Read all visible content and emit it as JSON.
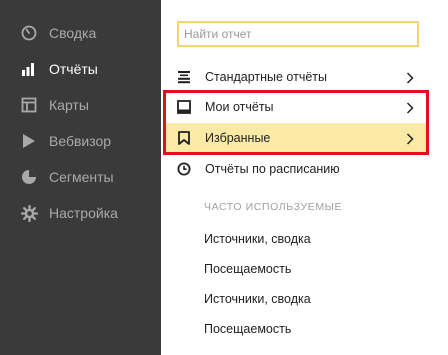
{
  "sidebar": {
    "items": [
      {
        "label": "Сводка",
        "icon": "dashboard-gauge-icon",
        "active": false
      },
      {
        "label": "Отчёты",
        "icon": "bar-chart-icon",
        "active": true
      },
      {
        "label": "Карты",
        "icon": "map-icon",
        "active": false
      },
      {
        "label": "Вебвизор",
        "icon": "play-icon",
        "active": false
      },
      {
        "label": "Сегменты",
        "icon": "pie-segments-icon",
        "active": false
      },
      {
        "label": "Настройка",
        "icon": "gear-icon",
        "active": false
      }
    ]
  },
  "panel": {
    "search_placeholder": "Найти отчет",
    "menu": [
      {
        "label": "Стандартные отчёты",
        "icon": "list-icon",
        "has_arrow": true
      },
      {
        "label": "Мои отчёты",
        "icon": "inbox-icon",
        "has_arrow": true
      },
      {
        "label": "Избранные",
        "icon": "bookmark-icon",
        "has_arrow": true,
        "highlighted": true
      },
      {
        "label": "Отчёты по расписанию",
        "icon": "clock-icon",
        "has_arrow": false
      }
    ],
    "section_title": "ЧАСТО ИСПОЛЬЗУЕМЫЕ",
    "frequent": [
      "Источники, сводка",
      "Посещаемость",
      "Источники, сводка",
      "Посещаемость"
    ]
  },
  "colors": {
    "sidebar_bg": "#3a3a3a",
    "search_border": "#f2d66b",
    "favorite_bg": "#fbe9a6",
    "annotation_red": "#e0101d"
  }
}
